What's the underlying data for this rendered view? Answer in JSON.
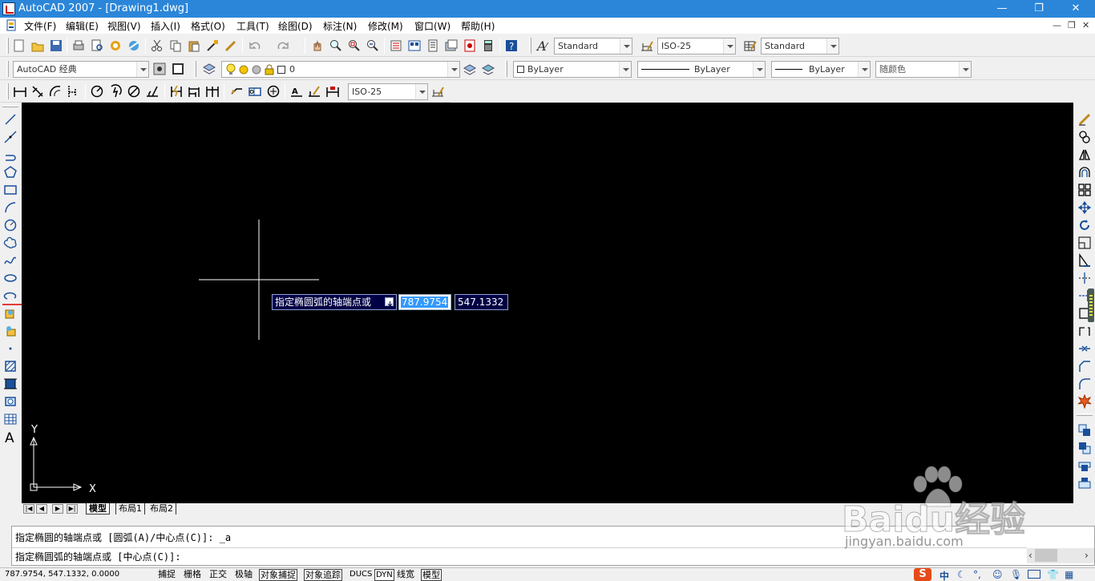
{
  "window": {
    "title": "AutoCAD 2007 - [Drawing1.dwg]"
  },
  "menu": [
    "文件(F)",
    "编辑(E)",
    "视图(V)",
    "插入(I)",
    "格式(O)",
    "工具(T)",
    "绘图(D)",
    "标注(N)",
    "修改(M)",
    "窗口(W)",
    "帮助(H)"
  ],
  "styles": {
    "text_style": "Standard",
    "dim_style": "ISO-25",
    "table_style": "Standard"
  },
  "workspace": "AutoCAD 经典",
  "layer": {
    "current": "0"
  },
  "properties": {
    "color": "ByLayer",
    "linetype": "ByLayer",
    "lineweight": "ByLayer",
    "plotstyle": "随颜色"
  },
  "dimension_toolbar": {
    "dim_style": "ISO-25"
  },
  "canvas": {
    "ucs_x": "X",
    "ucs_y": "Y",
    "dynamic_prompt": "指定椭圆弧的轴端点或",
    "dyn_input_x": "787.9754",
    "dyn_input_y": "547.1332"
  },
  "layout_tabs": [
    "模型",
    "布局1",
    "布局2"
  ],
  "command": {
    "line1": "指定椭圆的轴端点或 [圆弧(A)/中心点(C)]: _a",
    "line2": "指定椭圆弧的轴端点或 [中心点(C)]:"
  },
  "status": {
    "coords": "787.9754, 547.1332, 0.0000",
    "toggles": [
      "捕捉",
      "栅格",
      "正交",
      "极轴",
      "对象捕捉",
      "对象追踪",
      "DUCS",
      "DYN",
      "线宽",
      "模型"
    ],
    "active_toggles": [
      "对象捕捉",
      "对象追踪",
      "DYN",
      "模型"
    ]
  },
  "watermark": {
    "brand": "Baidu经验",
    "url": "jingyan.baidu.com"
  },
  "tray": {
    "ime": "中"
  },
  "colors": {
    "titlebar": "#2b86d9",
    "canvas": "#000000",
    "tooltip_bg": "#000044",
    "selection": "#3399ff"
  }
}
